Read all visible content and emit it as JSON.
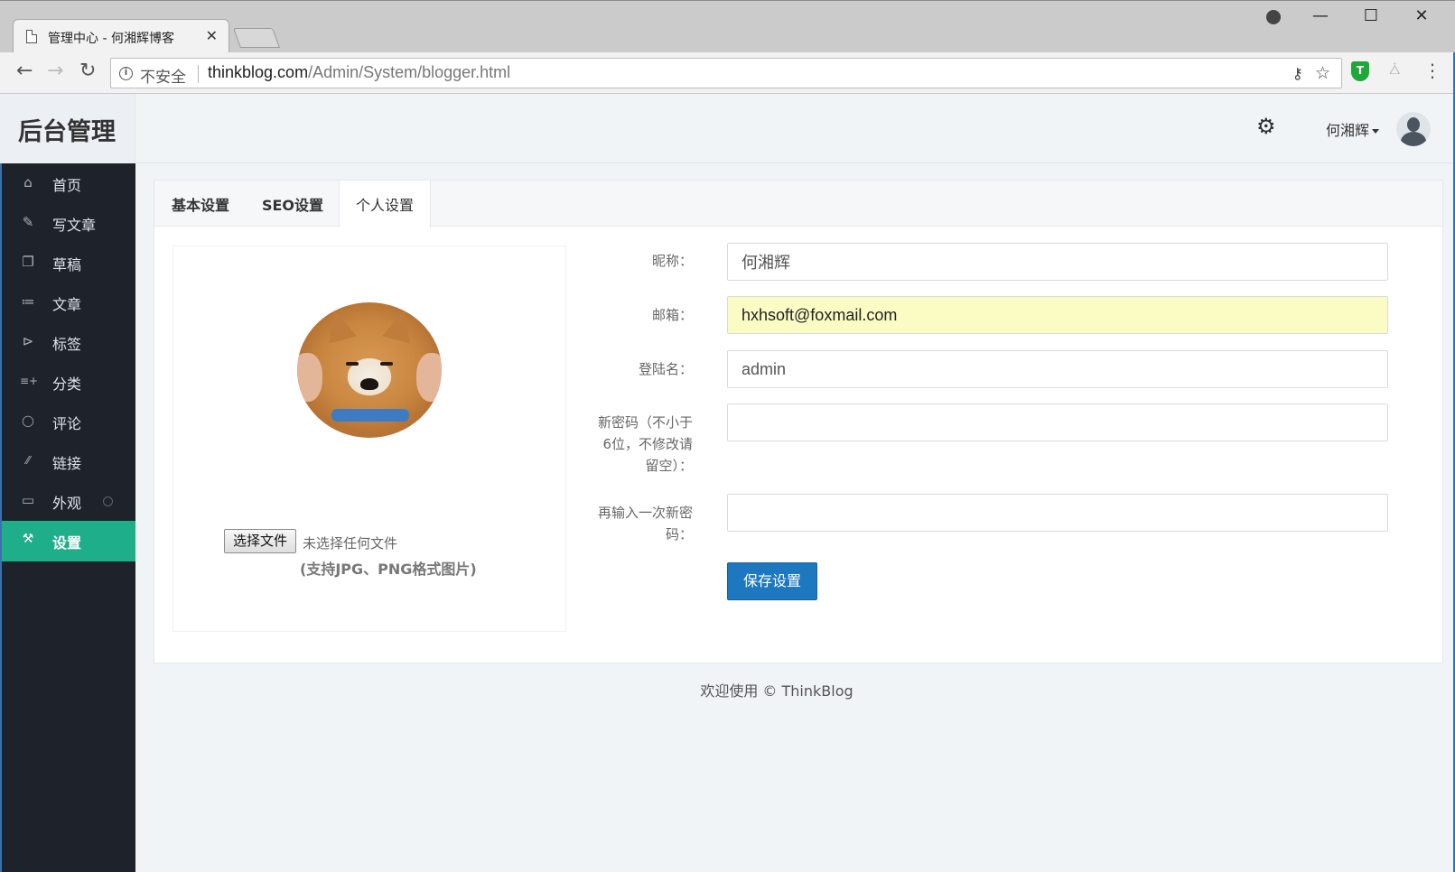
{
  "browser": {
    "tab_title": "管理中心 - 何湘辉博客",
    "tab_close": "✕",
    "insecure_label": "不安全",
    "url_host": "thinkblog.com",
    "url_path": "/Admin/System/blogger.html",
    "window_controls": {
      "minimize": "—",
      "maximize": "☐",
      "close": "✕"
    },
    "icons": [
      "back-icon",
      "forward-icon",
      "reload-icon",
      "info-icon",
      "key-icon",
      "star-icon",
      "shield-extension-icon",
      "network-extension-icon",
      "menu-icon",
      "account-icon"
    ]
  },
  "app": {
    "brand": "后台管理",
    "user_name": "何湘辉",
    "sidebar": {
      "items": [
        {
          "label": "首页",
          "icon": "home-icon",
          "glyph": "⌂"
        },
        {
          "label": "写文章",
          "icon": "edit-icon",
          "glyph": "✎"
        },
        {
          "label": "草稿",
          "icon": "copy-icon",
          "glyph": "❐"
        },
        {
          "label": "文章",
          "icon": "list-icon",
          "glyph": "≔"
        },
        {
          "label": "标签",
          "icon": "tag-icon",
          "glyph": "⊳"
        },
        {
          "label": "分类",
          "icon": "list-add-icon",
          "glyph": "≡+"
        },
        {
          "label": "评论",
          "icon": "comment-icon",
          "glyph": "◯"
        },
        {
          "label": "链接",
          "icon": "link-icon",
          "glyph": "⁄⁄"
        },
        {
          "label": "外观",
          "icon": "monitor-icon",
          "glyph": "▭"
        },
        {
          "label": "设置",
          "icon": "wrench-icon",
          "glyph": "🔧",
          "active": true
        }
      ],
      "active_color": "#1fae8a"
    },
    "tabs": [
      {
        "label": "基本设置"
      },
      {
        "label": "SEO设置"
      },
      {
        "label": "个人设置",
        "active": true
      }
    ],
    "upload": {
      "button": "选择文件",
      "status": "未选择任何文件",
      "hint": "(支持JPG、PNG格式图片)"
    },
    "form": {
      "nickname_label": "昵称：",
      "nickname_value": "何湘辉",
      "email_label": "邮箱：",
      "email_value": "hxhsoft@foxmail.com",
      "login_label": "登陆名：",
      "login_value": "admin",
      "new_password_label_l1": "新密码（不小于",
      "new_password_label_l2": "6位，不修改请",
      "new_password_label_l3": "留空）：",
      "new_password_value": "",
      "confirm_label_l1": "再输入一次新密",
      "confirm_label_l2": "码：",
      "confirm_value": "",
      "save_label": "保存设置",
      "save_color": "#1e78bf"
    },
    "footer": "欢迎使用 © ThinkBlog"
  }
}
